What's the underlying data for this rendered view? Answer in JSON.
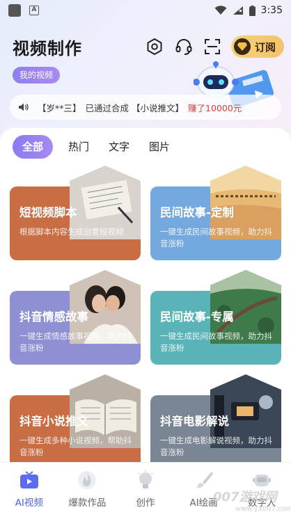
{
  "status_bar": {
    "time": "3:35"
  },
  "header": {
    "title": "视频制作",
    "subscribe_label": "订阅",
    "my_video_label": "我的视频"
  },
  "ticker": {
    "user": "【岁**三】",
    "action": "已通过合成",
    "topic": "【小说推文】",
    "earned": "赚了10000元"
  },
  "tabs": [
    {
      "label": "全部",
      "active": true
    },
    {
      "label": "热门",
      "active": false
    },
    {
      "label": "文字",
      "active": false
    },
    {
      "label": "图片",
      "active": false
    }
  ],
  "cards": [
    {
      "title": "短视频脚本",
      "desc": "根据脚本内容生成创意短视频",
      "color": "#c96d45"
    },
    {
      "title": "民间故事-定制",
      "desc": "一键生成民间故事视频，助力抖音涨粉",
      "color": "#74a9e0"
    },
    {
      "title": "抖音情感故事",
      "desc": "一键生成情感故事视频，助力抖音涨粉",
      "color": "#8f90d4"
    },
    {
      "title": "民间故事-专属",
      "desc": "一键生成民间故事视频，助力抖音涨粉",
      "color": "#5ab4b7"
    },
    {
      "title": "抖音小说推文",
      "desc": "一键生成多种小说视频，帮助抖音涨粉",
      "color": "#c96d45"
    },
    {
      "title": "抖音电影解说",
      "desc": "一键生成电影解说视频，助力抖音涨粉",
      "color": "#7b8694"
    }
  ],
  "bottom_nav": [
    {
      "label": "AI视频",
      "icon": "tv-icon",
      "active": true
    },
    {
      "label": "爆款作品",
      "icon": "flame-icon",
      "active": false
    },
    {
      "label": "创作",
      "icon": "bulb-icon",
      "active": false
    },
    {
      "label": "AI绘画",
      "icon": "brush-icon",
      "active": false
    },
    {
      "label": "数字人",
      "icon": "robot-icon",
      "active": false
    }
  ],
  "watermark": {
    "main": "007游戏网",
    "sub": "www.yx007.com"
  },
  "colors": {
    "accent": "#8a7cf2",
    "nav_active": "#4a63e6",
    "highlight": "#e23b3b"
  }
}
